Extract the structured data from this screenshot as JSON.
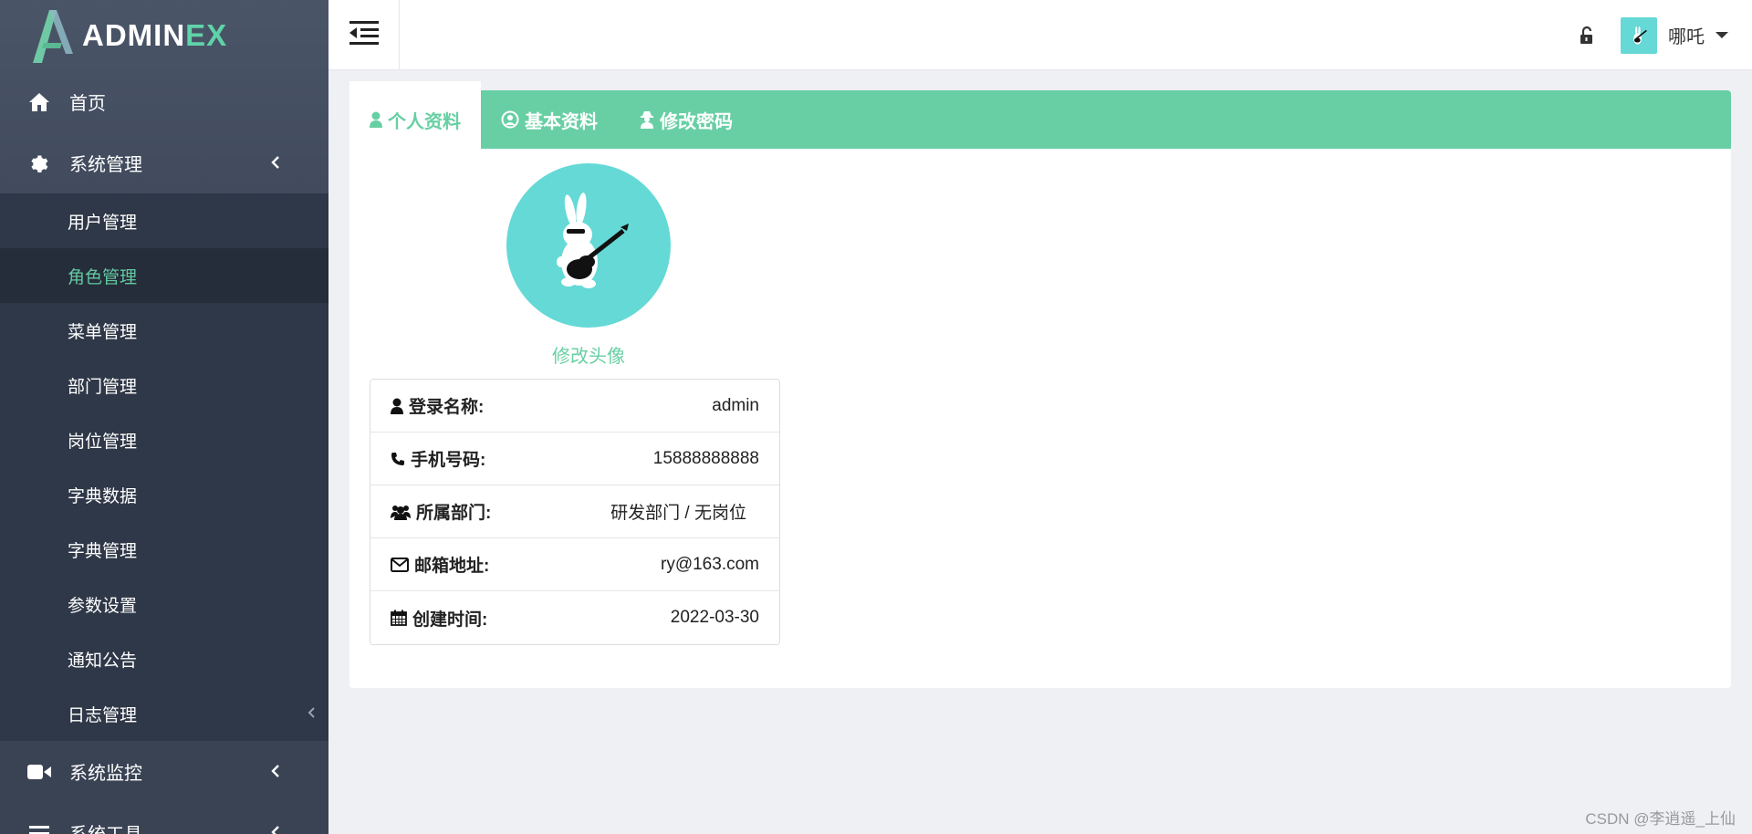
{
  "brand": {
    "name_main": "ADMIN",
    "name_accent": "EX"
  },
  "sidebar": {
    "top_items": [
      {
        "label": "首页",
        "icon": "home-icon"
      },
      {
        "label": "系统管理",
        "icon": "gear-icon"
      }
    ],
    "sub_items": [
      {
        "label": "用户管理"
      },
      {
        "label": "角色管理",
        "active": true
      },
      {
        "label": "菜单管理"
      },
      {
        "label": "部门管理"
      },
      {
        "label": "岗位管理"
      },
      {
        "label": "字典数据"
      },
      {
        "label": "字典管理"
      },
      {
        "label": "参数设置"
      },
      {
        "label": "通知公告"
      },
      {
        "label": "日志管理"
      }
    ],
    "lower_items": [
      {
        "label": "系统监控",
        "icon": "video-icon"
      },
      {
        "label": "系统工具",
        "icon": "list-icon"
      }
    ]
  },
  "header": {
    "user_name": "哪吒"
  },
  "tabs": [
    {
      "label": "个人资料",
      "icon": "user-icon",
      "active": true
    },
    {
      "label": "基本资料",
      "icon": "user-circle-icon"
    },
    {
      "label": "修改密码",
      "icon": "user-secret-icon"
    }
  ],
  "profile": {
    "change_avatar": "修改头像",
    "rows": [
      {
        "label": "登录名称:",
        "value": "admin",
        "icon": "user-icon"
      },
      {
        "label": "手机号码:",
        "value": "15888888888",
        "icon": "phone-icon"
      },
      {
        "label": "所属部门:",
        "value": "研发部门 / 无岗位",
        "icon": "users-icon"
      },
      {
        "label": "邮箱地址:",
        "value": "ry@163.com",
        "icon": "envelope-icon"
      },
      {
        "label": "创建时间:",
        "value": "2022-03-30",
        "icon": "calendar-icon"
      }
    ]
  },
  "watermark": "CSDN @李逍遥_上仙",
  "colors": {
    "accent": "#68cfa4",
    "sidebar_bg": "#3a4354",
    "avatar_bg": "#64d9d6"
  }
}
